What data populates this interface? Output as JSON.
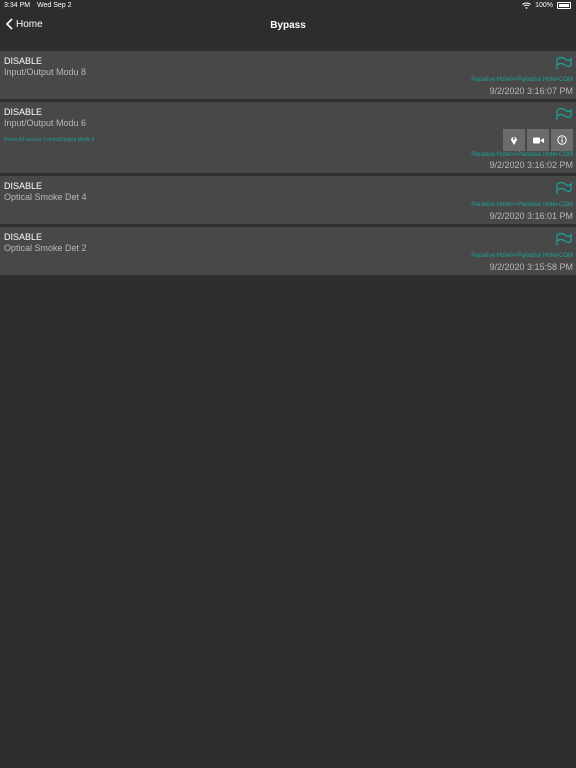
{
  "status": {
    "time": "3:34 PM",
    "date": "Wed Sep 2",
    "battery": "100%"
  },
  "nav": {
    "back_label": "Home",
    "title": "Bypass"
  },
  "items": [
    {
      "state": "DISABLE",
      "device": "Input/Output Modu 8",
      "source": "Paradise Hotel>>Paradise Hotel-COM",
      "timestamp": "9/2/2020 3:16:07 PM"
    },
    {
      "state": "DISABLE",
      "device": "Input/Output Modu 6",
      "path": "Room A2-access 1>Input/Output Modu 6",
      "source": "Paradise Hotel>>Paradise Hotel-COM",
      "timestamp": "9/2/2020 3:16:02 PM",
      "actions": [
        "map-pin-icon",
        "video-icon",
        "info-icon"
      ]
    },
    {
      "state": "DISABLE",
      "device": "Optical Smoke Det 4",
      "source": "Paradise Hotel>>Paradise Hotel-COM",
      "timestamp": "9/2/2020 3:16:01 PM"
    },
    {
      "state": "DISABLE",
      "device": "Optical Smoke Det 2",
      "source": "Paradise Hotel>>Paradise Hotel-COM",
      "timestamp": "9/2/2020 3:15:58 PM"
    }
  ],
  "colors": {
    "accent": "#1aa39a",
    "row_bg": "#484848",
    "page_bg": "#2d2d2d"
  }
}
